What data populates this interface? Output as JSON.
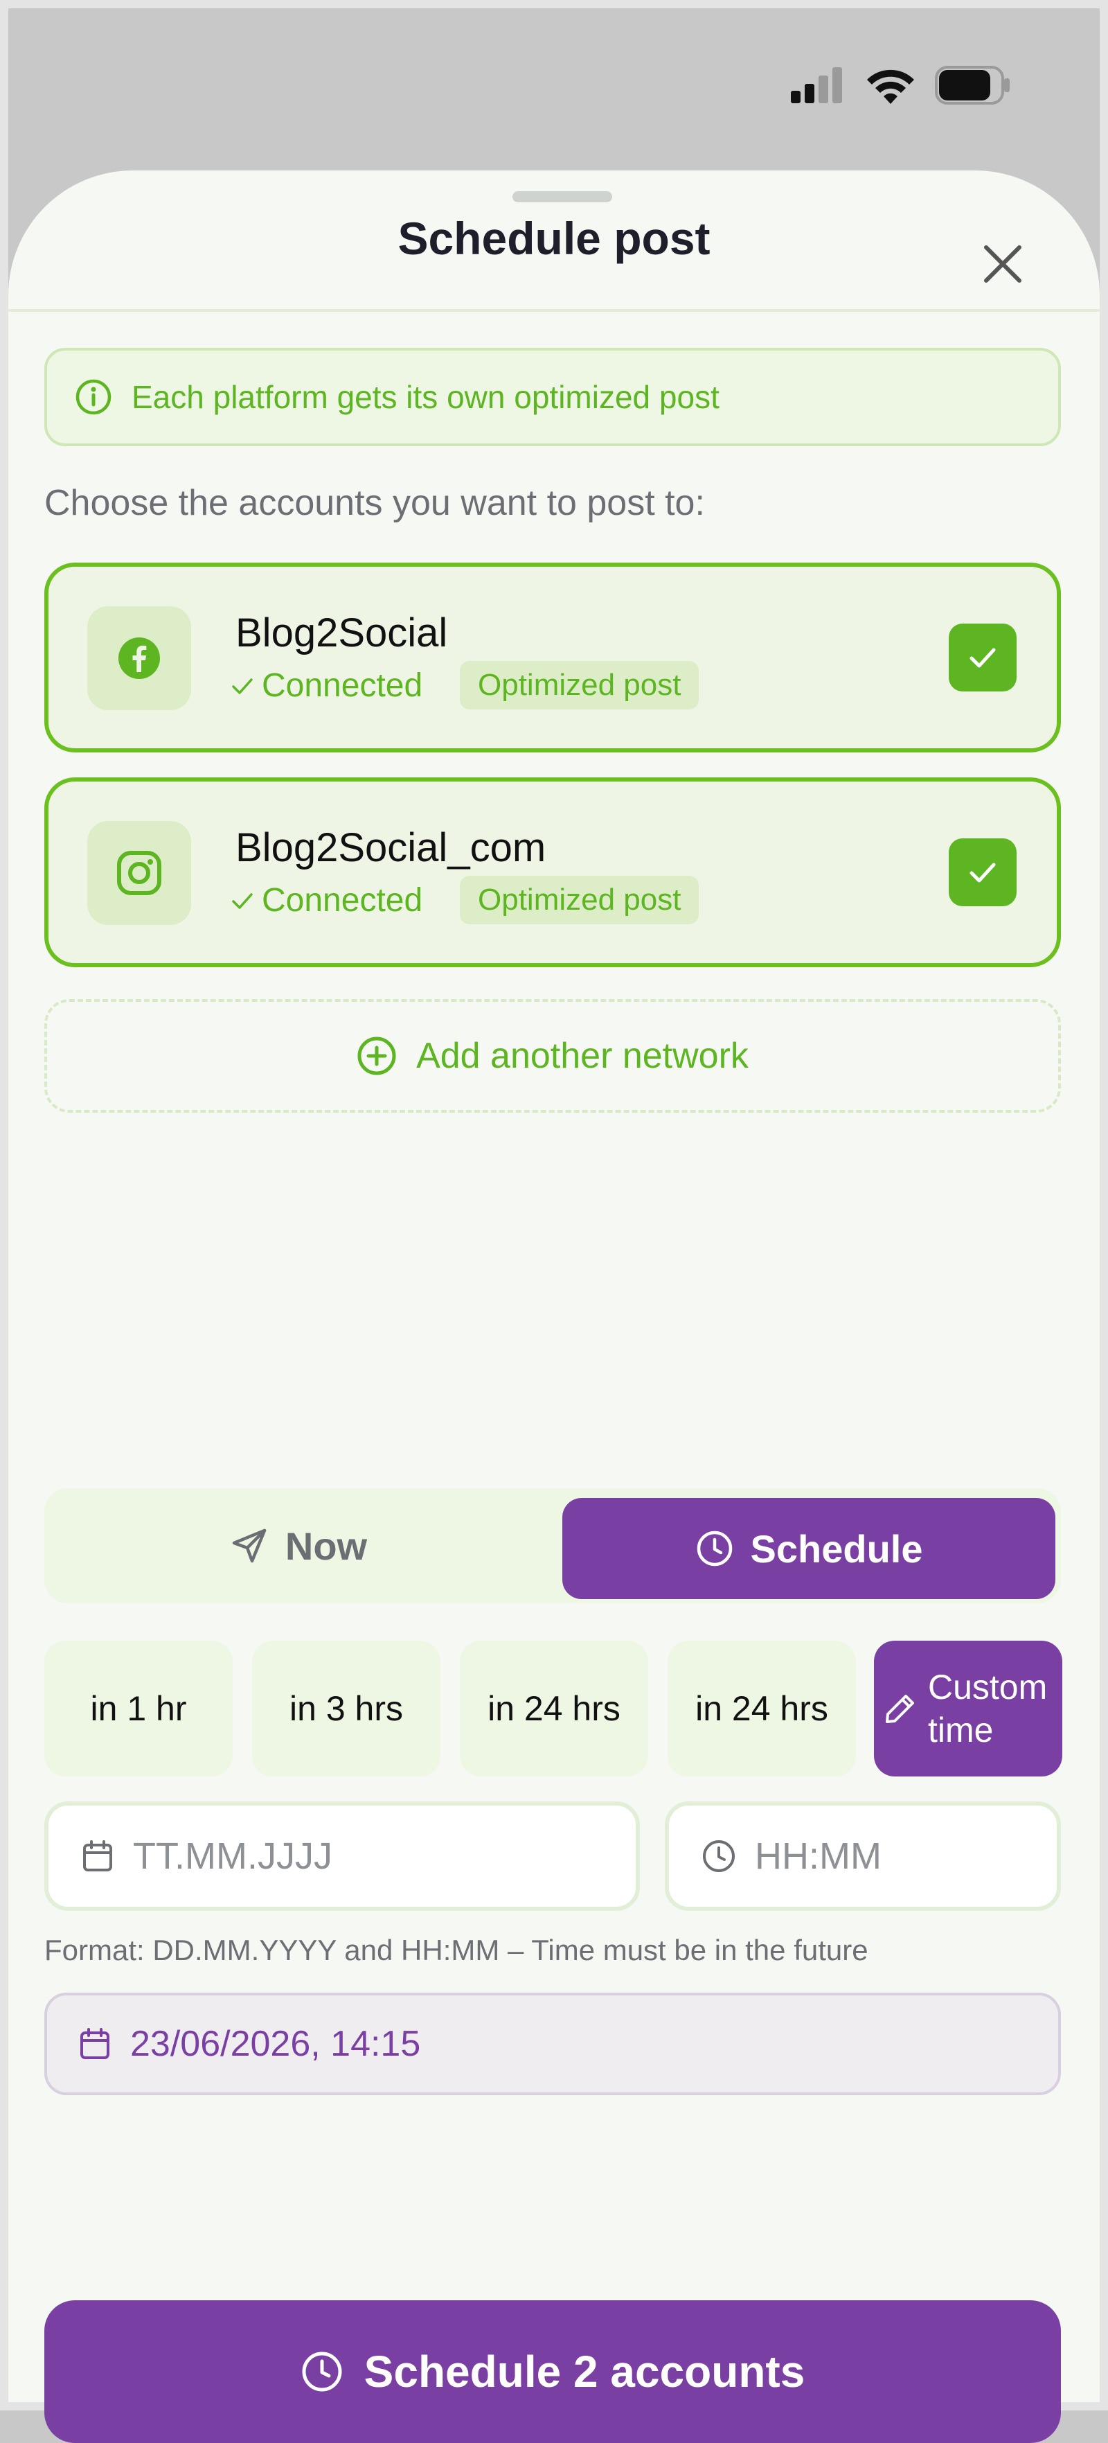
{
  "sheet": {
    "title": "Schedule post",
    "info_banner": "Each platform gets its own optimized post",
    "choose_label": "Choose the accounts you want to post to:"
  },
  "accounts": [
    {
      "name": "Blog2Social",
      "platform_icon": "facebook-icon",
      "status": "Connected",
      "badge": "Optimized post",
      "selected": true
    },
    {
      "name": "Blog2Social_com",
      "platform_icon": "instagram-icon",
      "status": "Connected",
      "badge": "Optimized post",
      "selected": true
    }
  ],
  "add_network_label": "Add another network",
  "mode": {
    "now_label": "Now",
    "schedule_label": "Schedule",
    "active": "Schedule"
  },
  "quick_options": [
    {
      "label": "in 1 hr"
    },
    {
      "label": "in 3 hrs"
    },
    {
      "label": "in 24 hrs"
    },
    {
      "label": "in 24 hrs"
    },
    {
      "label": "Custom time",
      "active": true
    }
  ],
  "date_input": {
    "placeholder": "TT.MM.JJJJ",
    "value": ""
  },
  "time_input": {
    "placeholder": "HH:MM",
    "value": ""
  },
  "format_hint": "Format: DD.MM.YYYY and HH:MM – Time must be in the future",
  "selected_datetime": "23/06/2026, 14:15",
  "submit_label": "Schedule 2 accounts",
  "colors": {
    "brand_green": "#5cb521",
    "brand_purple": "#7a3fa3",
    "sheet_bg": "#f6f8f4"
  }
}
